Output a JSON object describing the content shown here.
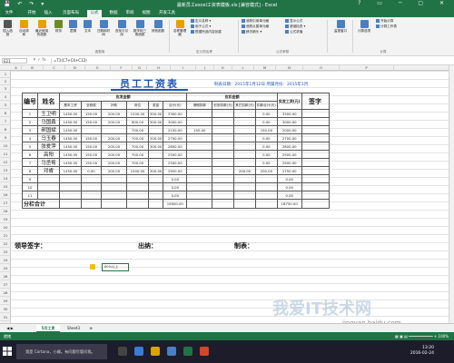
{
  "window": {
    "title": "最新员工excel工资表模板.xls [兼容模式] - Excel",
    "quick_access": "💾 ↶ ↷ ▾",
    "controls": "? ▭ ─ ▢ ✕"
  },
  "ribbon_tabs": [
    "文件",
    "开始",
    "插入",
    "页面布局",
    "公式",
    "数据",
    "审阅",
    "视图",
    "开发工具"
  ],
  "ribbon": {
    "insert_function": "插入函数",
    "autosum": "自动求和",
    "recent": "最近使用的函数",
    "financial": "财务",
    "logical": "逻辑",
    "text": "文本",
    "datetime": "日期和时间",
    "lookup": "查找与引用",
    "math": "数学和三角函数",
    "other": "其他函数",
    "name_manager": "名称管理器",
    "define_name": "定义名称 ▾",
    "use_in_formula": "用于公式 ▾",
    "create_from_sel": "根据所选内容创建",
    "trace_precedents": "追踪引用单元格",
    "trace_dependents": "追踪从属单元格",
    "remove_arrows": "移去箭头 ▾",
    "show_formulas": "显示公式",
    "error_checking": "错误检查 ▾",
    "evaluate": "公式求值",
    "watch": "监视窗口",
    "calc_options": "计算选项",
    "calc_now": "开始计算",
    "calc_sheet": "计算工作表",
    "grp_library": "函数库",
    "grp_names": "定义的名称",
    "grp_audit": "公式审核",
    "grp_calc": "计算"
  },
  "formula_bar": {
    "name_box": "E21",
    "fx": "✕ ✓ fx",
    "formula": "=T1(C7+C4+C12)"
  },
  "columns": [
    "A",
    "B",
    "C",
    "D",
    "E",
    "F",
    "G",
    "H",
    "I",
    "J",
    "K",
    "L",
    "M",
    "N",
    "O",
    "P"
  ],
  "rows": [
    "1",
    "2",
    "3",
    "4",
    "5",
    "6",
    "7",
    "8",
    "9",
    "10",
    "11",
    "12",
    "13",
    "14",
    "15",
    "16",
    "17",
    "18",
    "19",
    "20",
    "21",
    "22",
    "23",
    "24",
    "25",
    "26",
    "27",
    "28",
    "29",
    "30",
    "31",
    "32"
  ],
  "sheet": {
    "title": "员工工资表",
    "date_line": "制表日期：2015年1月12日  所属月份：2015年1月",
    "hdr_no": "编号",
    "hdr_name": "姓名",
    "hdr_earn": "应发金额",
    "hdr_deduct": "应扣金额",
    "hdr_net": "实发工资(元)",
    "hdr_sign": "签字",
    "earn_cols": [
      "基本工资",
      "全勤奖",
      "补助",
      "岗位",
      "奖金",
      "合计(元)"
    ],
    "deduct_cols": [
      "请假扣款",
      "迟到扣款(元)",
      "其它扣款(元)",
      "扣款合计(元)"
    ],
    "rows": [
      {
        "no": "1",
        "name": "王卫明",
        "c": [
          "1450.00",
          "150.00",
          "200.00",
          "1200.00",
          "300.00",
          "3300.00",
          "",
          "",
          "",
          "0.00",
          "3300.00"
        ]
      },
      {
        "no": "2",
        "name": "马国鑫",
        "c": [
          "1450.00",
          "150.00",
          "200.00",
          "900.00",
          "300.00",
          "3000.00",
          "",
          "",
          "",
          "0.00",
          "3000.00"
        ]
      },
      {
        "no": "3",
        "name": "郝国斌",
        "c": [
          "1450.00",
          "",
          "",
          "700.00",
          "",
          "2150.00",
          "150.00",
          "",
          "",
          "150.00",
          "2000.00"
        ]
      },
      {
        "no": "4",
        "name": "马玉春",
        "c": [
          "1450.00",
          "150.00",
          "200.00",
          "700.00",
          "200.00",
          "2700.00",
          "",
          "",
          "",
          "0.00",
          "2700.00"
        ]
      },
      {
        "no": "5",
        "name": "张爱萍",
        "c": [
          "1450.00",
          "150.00",
          "200.00",
          "700.00",
          "300.00",
          "2800.00",
          "",
          "",
          "",
          "0.00",
          "2800.00"
        ]
      },
      {
        "no": "6",
        "name": "高阳",
        "c": [
          "1450.00",
          "150.00",
          "200.00",
          "700.00",
          "",
          "2500.00",
          "",
          "",
          "",
          "0.00",
          "2500.00"
        ]
      },
      {
        "no": "7",
        "name": "马丞荀",
        "c": [
          "1450.00",
          "150.00",
          "200.00",
          "700.00",
          "",
          "2500.00",
          "",
          "",
          "",
          "0.00",
          "2500.00"
        ]
      },
      {
        "no": "8",
        "name": "邓睿",
        "c": [
          "1450.00",
          "0.00",
          "200.00",
          "1000.00",
          "300.00",
          "2950.00",
          "",
          "",
          "200.00",
          "200.00",
          "2750.00"
        ]
      },
      {
        "no": "9",
        "name": "",
        "c": [
          "",
          "",
          "",
          "",
          "",
          "0.00",
          "",
          "",
          "",
          "",
          "0.00"
        ]
      },
      {
        "no": "10",
        "name": "",
        "c": [
          "",
          "",
          "",
          "",
          "",
          "0.00",
          "",
          "",
          "",
          "",
          "0.00"
        ]
      },
      {
        "no": "11",
        "name": "",
        "c": [
          "",
          "",
          "",
          "",
          "",
          "0.00",
          "",
          "",
          "",
          "",
          "0.00"
        ]
      }
    ],
    "total_label": "分栏合计",
    "total_sum": "19500.00",
    "total_net": "18750.00",
    "sign_leader": "领导签字：",
    "sign_cashier": "出纳：",
    "sign_maker": "制表：",
    "note_cell": "80%以上"
  },
  "sheet_tabs": {
    "nav": "◀ ▶",
    "tabs": [
      "5月工资",
      "Sheet3"
    ],
    "add": "⊕"
  },
  "status": {
    "text": "就绪",
    "zoom": "▦ ▣ ▤  ━━━━━━━━━━━  + 100%"
  },
  "taskbar": {
    "search": "我是 Cortana，小娜。有问题尽管问我。",
    "time": "13:20",
    "date": "2016-02-24"
  },
  "watermark": {
    "main": "我爱IT技术网",
    "url": "jingyan.baidu.com"
  },
  "colors": {
    "excel_green": "#217346",
    "title_blue": "#1c55b5"
  }
}
